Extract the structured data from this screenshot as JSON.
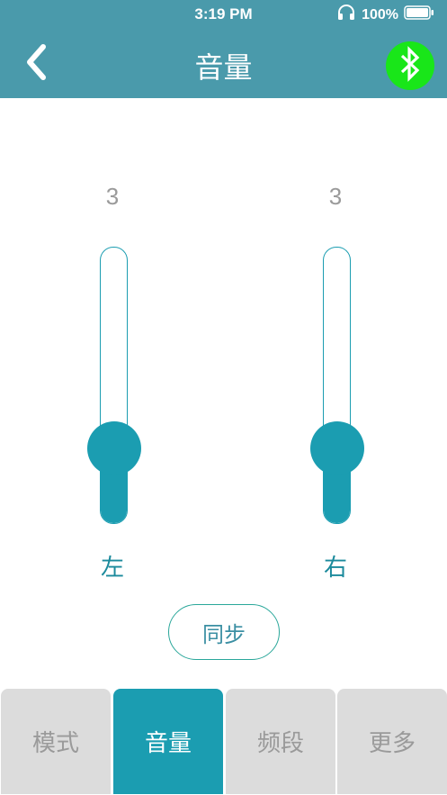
{
  "status_bar": {
    "time": "3:19 PM",
    "battery": "100%"
  },
  "nav": {
    "title": "音量",
    "back_icon": "chevron-left-icon",
    "bluetooth_icon": "bluetooth-icon",
    "bluetooth_color": "#19e619"
  },
  "channels": [
    {
      "label": "左",
      "value": "3",
      "level": 0.27
    },
    {
      "label": "右",
      "value": "3",
      "level": 0.27
    }
  ],
  "sync_button": "同步",
  "tabs": [
    {
      "label": "模式",
      "active": false
    },
    {
      "label": "音量",
      "active": true
    },
    {
      "label": "频段",
      "active": false
    },
    {
      "label": "更多",
      "active": false
    }
  ],
  "colors": {
    "header": "#4a9aab",
    "accent": "#1b9db1",
    "tab_inactive": "#dcdcdc"
  }
}
